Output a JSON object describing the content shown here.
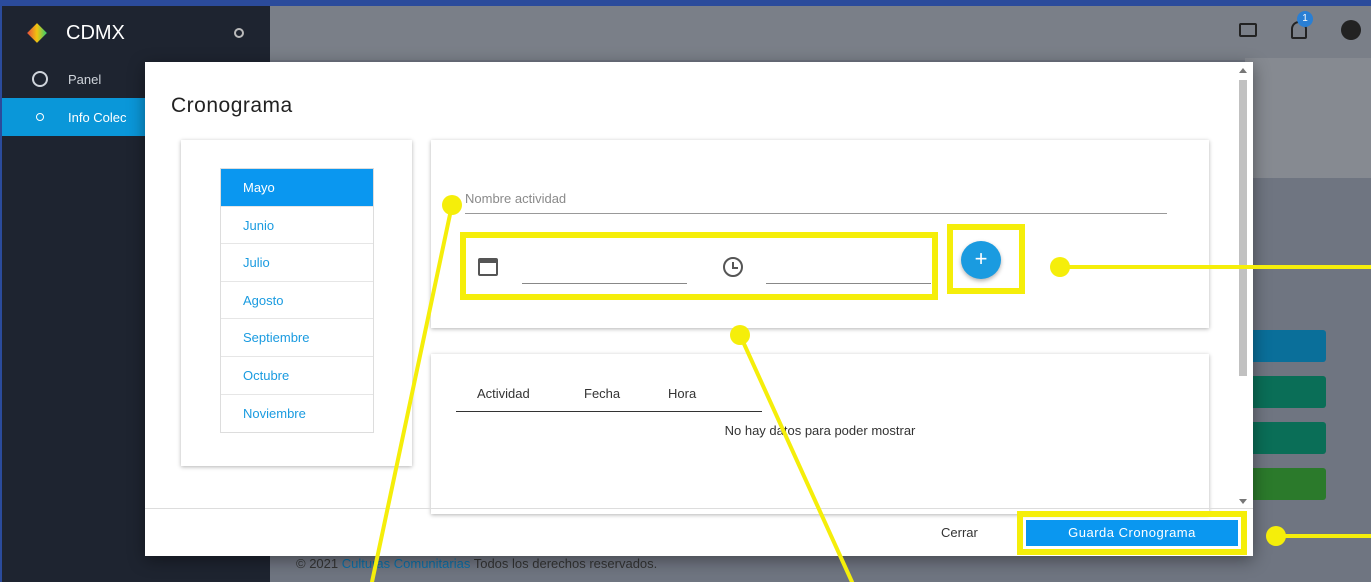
{
  "app": {
    "brand": "CDMX",
    "notification_count": "1",
    "sidebar": [
      {
        "label": "Panel",
        "active": false
      },
      {
        "label": "Info Colec",
        "active": true
      }
    ],
    "footer": {
      "prefix": "© 2021 ",
      "link": "Culturas Comunitarias",
      "suffix": " Todos los derechos reservados."
    }
  },
  "modal": {
    "title": "Cronograma",
    "months": [
      "Mayo",
      "Junio",
      "Julio",
      "Agosto",
      "Septiembre",
      "Octubre",
      "Noviembre"
    ],
    "selected_month": "Mayo",
    "activity_placeholder": "Nombre actividad",
    "add_label": "+",
    "table": {
      "columns": [
        "Actividad",
        "Fecha",
        "Hora"
      ],
      "empty_message": "No hay datos para poder mostrar"
    },
    "close_label": "Cerrar",
    "save_label": "Guarda Cronograma"
  },
  "colors": {
    "accent": "#0a97f0",
    "highlight": "#f5ee0a"
  }
}
